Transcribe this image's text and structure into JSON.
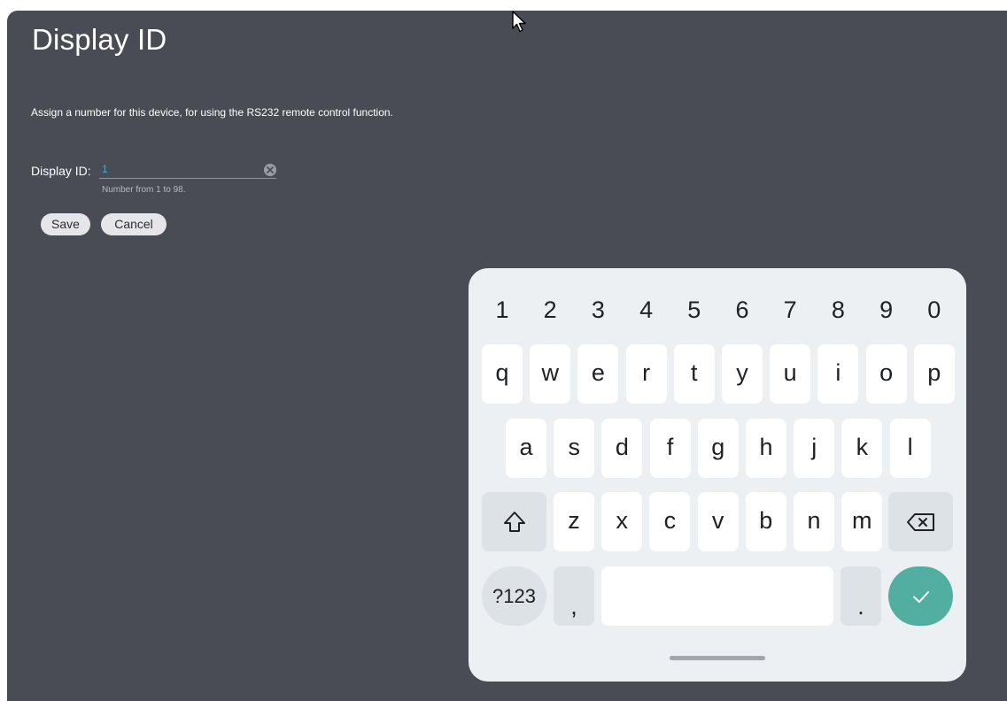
{
  "page": {
    "title": "Display ID",
    "description": "Assign a number for this device, for using the RS232 remote control function."
  },
  "field": {
    "label": "Display ID:",
    "value": "1",
    "helper": "Number from 1 to 98."
  },
  "buttons": {
    "save": "Save",
    "cancel": "Cancel"
  },
  "keyboard": {
    "number_row": [
      "1",
      "2",
      "3",
      "4",
      "5",
      "6",
      "7",
      "8",
      "9",
      "0"
    ],
    "row1": [
      "q",
      "w",
      "e",
      "r",
      "t",
      "y",
      "u",
      "i",
      "o",
      "p"
    ],
    "row2": [
      "a",
      "s",
      "d",
      "f",
      "g",
      "h",
      "j",
      "k",
      "l"
    ],
    "row3": [
      "z",
      "x",
      "c",
      "v",
      "b",
      "n",
      "m"
    ],
    "symbols_key": "?123",
    "comma_key": ",",
    "period_key": ".",
    "icons": {
      "shift": "shift-icon",
      "backspace": "backspace-icon",
      "enter": "checkmark-icon"
    }
  },
  "colors": {
    "background": "#494b55",
    "accent": "#5aa6c8",
    "keyboard_bg": "#edf0f3",
    "enter_key": "#52aea1"
  }
}
